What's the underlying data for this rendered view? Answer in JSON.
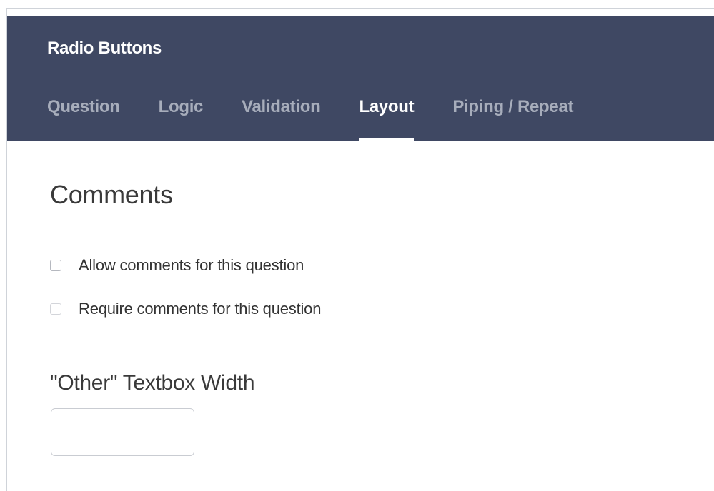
{
  "header": {
    "title": "Radio Buttons",
    "tabs": [
      {
        "label": "Question",
        "active": false
      },
      {
        "label": "Logic",
        "active": false
      },
      {
        "label": "Validation",
        "active": false
      },
      {
        "label": "Layout",
        "active": true
      },
      {
        "label": "Piping / Repeat",
        "active": false
      }
    ]
  },
  "comments": {
    "title": "Comments",
    "options": [
      {
        "label": "Allow comments for this question",
        "checked": false
      },
      {
        "label": "Require comments for this question",
        "checked": false
      }
    ]
  },
  "other_textbox": {
    "label": "\"Other\" Textbox Width",
    "value": ""
  },
  "colors": {
    "header_bg": "#3f4863",
    "tab_inactive": "#a7adbb",
    "tab_active": "#ffffff"
  }
}
